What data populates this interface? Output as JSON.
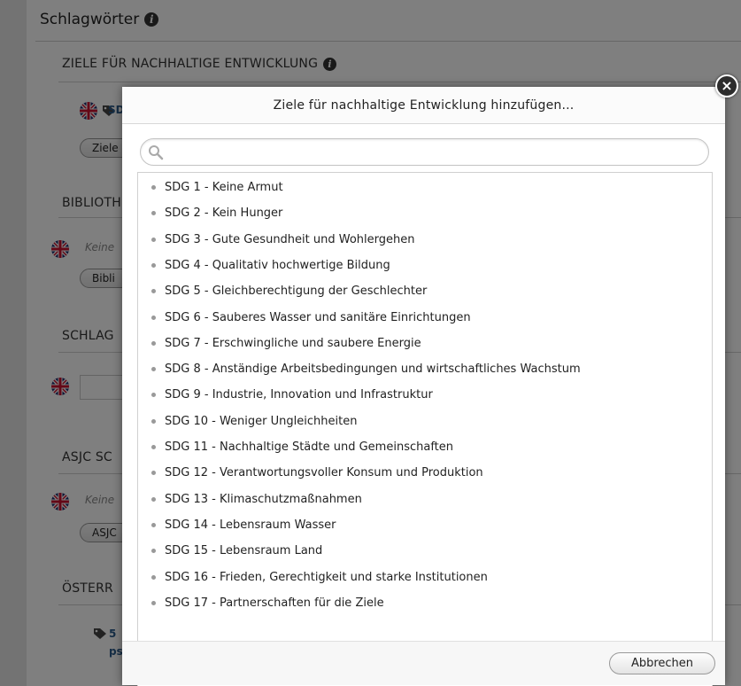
{
  "background": {
    "section_title": "Schlagwörter",
    "sdg_heading": "ZIELE FÜR NACHHALTIGE ENTWICKLUNG",
    "sdg_tag_partial": "SD",
    "sdg_button_partial": "Ziele",
    "library_heading_partial": "BIBLIOTH",
    "library_empty_partial": "Keine",
    "library_button_partial": "Bibli",
    "keywords_heading_partial": "SCHLAG",
    "asjc_heading_partial": "ASJC SC",
    "asjc_empty_partial": "Keine",
    "asjc_button_partial": "ASJC",
    "austria_heading_partial": "ÖSTERR",
    "austria_tag_partial": "5",
    "austria_link_partial": "ps"
  },
  "modal": {
    "title": "Ziele für nachhaltige Entwicklung hinzufügen...",
    "search_placeholder": "",
    "items": [
      "SDG 1 - Keine Armut",
      "SDG 2 - Kein Hunger",
      "SDG 3 - Gute Gesundheit und Wohlergehen",
      "SDG 4 - Qualitativ hochwertige Bildung",
      "SDG 5 - Gleichberechtigung der Geschlechter",
      "SDG 6 - Sauberes Wasser und sanitäre Einrichtungen",
      "SDG 7 - Erschwingliche und saubere Energie",
      "SDG 8 - Anständige Arbeitsbedingungen und wirtschaftliches Wachstum",
      "SDG 9 - Industrie, Innovation und Infrastruktur",
      "SDG 10 - Weniger Ungleichheiten",
      "SDG 11 - Nachhaltige Städte und Gemeinschaften",
      "SDG 12 - Verantwortungsvoller Konsum und Produktion",
      "SDG 13 - Klimaschutzmaßnahmen",
      "SDG 14 - Lebensraum Wasser",
      "SDG 15 - Lebensraum Land",
      "SDG 16 - Frieden, Gerechtigkeit und starke Institutionen",
      "SDG 17 - Partnerschaften für die Ziele"
    ],
    "cancel_label": "Abbrechen",
    "close_glyph": "×"
  },
  "icons": {
    "close": "close-icon",
    "search": "search-icon",
    "flag": "uk-flag-icon",
    "tag": "tag-icon",
    "info": "info-icon"
  },
  "colors": {
    "overlay": "#000000",
    "modal_bg": "#ffffff",
    "close_bg": "#2d2d2d",
    "bullet": "#999999"
  }
}
